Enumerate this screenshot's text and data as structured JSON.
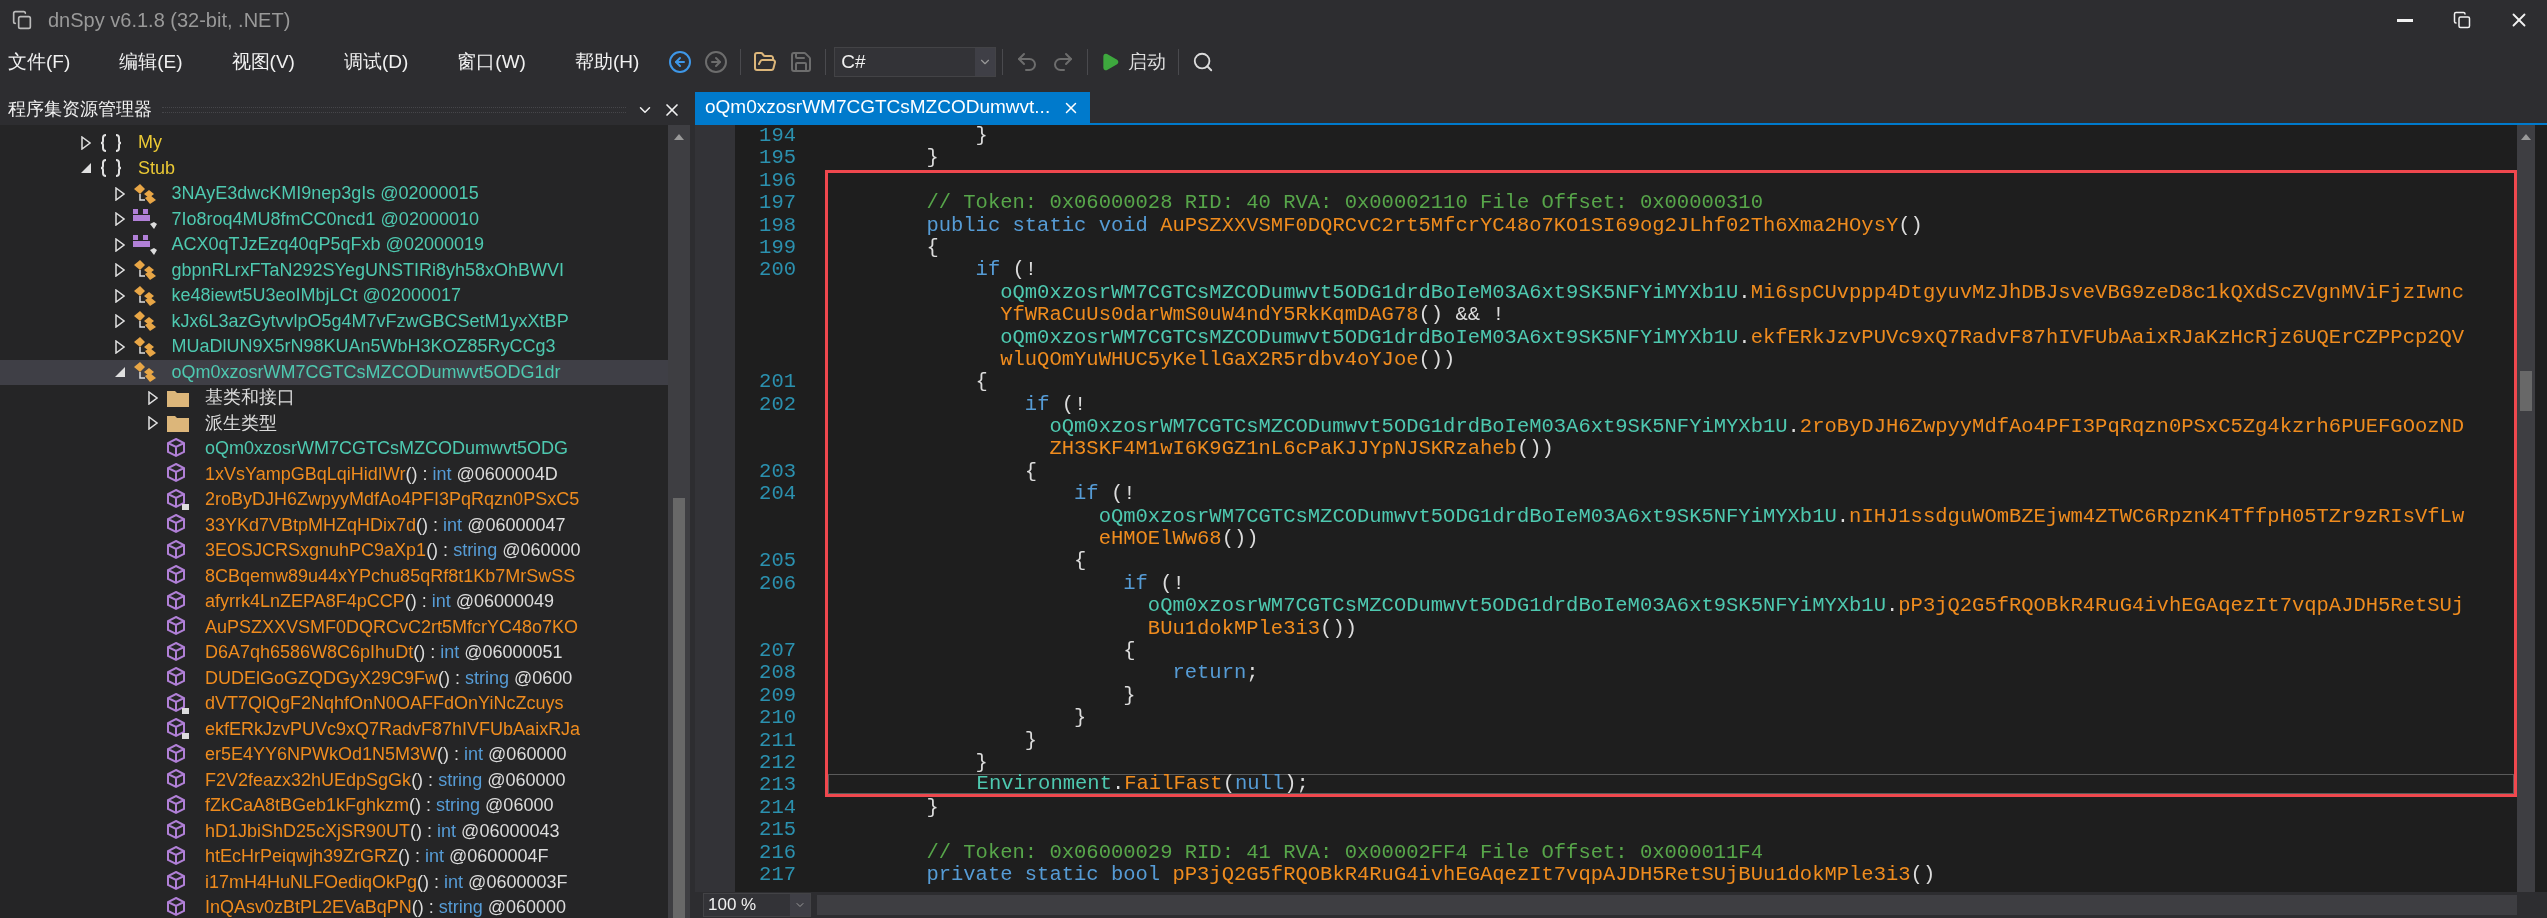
{
  "window": {
    "title": "dnSpy v6.1.8 (32-bit, .NET)"
  },
  "menu": [
    "文件(F)",
    "编辑(E)",
    "视图(V)",
    "调试(D)",
    "窗口(W)",
    "帮助(H)"
  ],
  "toolbar": [
    {
      "kind": "back",
      "disabled": false
    },
    {
      "kind": "forward",
      "disabled": true
    },
    {
      "kind": "separator"
    },
    {
      "kind": "open",
      "disabled": false
    },
    {
      "kind": "save",
      "disabled": true
    },
    {
      "kind": "separator"
    },
    {
      "kind": "language",
      "value": "C#"
    },
    {
      "kind": "separator"
    },
    {
      "kind": "undo",
      "disabled": true
    },
    {
      "kind": "redo",
      "disabled": true
    },
    {
      "kind": "separator"
    },
    {
      "kind": "run",
      "label": "启动",
      "disabled": false
    },
    {
      "kind": "separator"
    },
    {
      "kind": "search",
      "disabled": false
    }
  ],
  "explorer": {
    "title": "程序集资源管理器",
    "tree": [
      {
        "kind": "namespace",
        "label": "My",
        "expanded": false,
        "selected": false
      },
      {
        "kind": "namespace",
        "label": "Stub",
        "expanded": true,
        "selected": false,
        "children": [
          {
            "kind": "class",
            "label": "3NAyE3dwcKMI9nep3gIs @02000015",
            "expanded": false,
            "selected": false
          },
          {
            "kind": "struct",
            "label": "7Io8roq4MU8fmCC0ncd1 @02000010",
            "expanded": false,
            "selected": false
          },
          {
            "kind": "struct",
            "label": "ACX0qTJzEzq40qP5qFxb @02000019",
            "expanded": false,
            "selected": false
          },
          {
            "kind": "class",
            "label": "gbpnRLrxFTaN292SYegUNSTIRi8yh58xOhBWVI",
            "expanded": false,
            "selected": false
          },
          {
            "kind": "class",
            "label": "ke48iewt5U3eoIMbjLCt @02000017",
            "expanded": false,
            "selected": false
          },
          {
            "kind": "class",
            "label": "kJx6L3azGytvvlpO5g4M7vFzwGBCSetM1yxXtBP",
            "expanded": false,
            "selected": false
          },
          {
            "kind": "class",
            "label": "MUaDlUN9X5rN98KUAn5WbH3KOZ85RyCCg3",
            "expanded": false,
            "selected": false
          },
          {
            "kind": "class",
            "label": "oQm0xzosrWM7CGTCsMZCODumwvt5ODG1dr",
            "expanded": true,
            "selected": true,
            "children": [
              {
                "kind": "folder",
                "label": "基类和接口",
                "expanded": false,
                "selected": false
              },
              {
                "kind": "folder",
                "label": "派生类型",
                "expanded": false,
                "selected": false
              },
              {
                "kind": "method",
                "locked": false,
                "selected": false,
                "tokens": [
                  {
                    "kind": "type",
                    "text": "oQm0xzosrWM7CGTCsMZCODumwvt5ODG"
                  }
                ]
              },
              {
                "kind": "method",
                "locked": false,
                "selected": false,
                "tokens": [
                  {
                    "kind": "member",
                    "text": "1xVsYampGBqLqiHidIWr"
                  },
                  {
                    "kind": "plain",
                    "text": "() : "
                  },
                  {
                    "kind": "keyword",
                    "text": "int"
                  },
                  {
                    "kind": "plain",
                    "text": " @0600004D"
                  }
                ]
              },
              {
                "kind": "method",
                "locked": true,
                "selected": false,
                "tokens": [
                  {
                    "kind": "member",
                    "text": "2roByDJH6ZwpyyMdfAo4PFI3PqRqzn0PSxC5"
                  }
                ]
              },
              {
                "kind": "method",
                "locked": false,
                "selected": false,
                "tokens": [
                  {
                    "kind": "member",
                    "text": "33YKd7VBtpMHZqHDix7d"
                  },
                  {
                    "kind": "plain",
                    "text": "() : "
                  },
                  {
                    "kind": "keyword",
                    "text": "int"
                  },
                  {
                    "kind": "plain",
                    "text": " @06000047"
                  }
                ]
              },
              {
                "kind": "method",
                "locked": false,
                "selected": false,
                "tokens": [
                  {
                    "kind": "member",
                    "text": "3EOSJCRSxgnuhPC9aXp1"
                  },
                  {
                    "kind": "plain",
                    "text": "() : "
                  },
                  {
                    "kind": "keyword",
                    "text": "string"
                  },
                  {
                    "kind": "plain",
                    "text": " @060000"
                  }
                ]
              },
              {
                "kind": "method",
                "locked": false,
                "selected": false,
                "tokens": [
                  {
                    "kind": "member",
                    "text": "8CBqemw89u44xYPchu85qRf8t1Kb7MrSwSS"
                  }
                ]
              },
              {
                "kind": "method",
                "locked": false,
                "selected": false,
                "tokens": [
                  {
                    "kind": "member",
                    "text": "afyrrk4LnZEPA8F4pCCP"
                  },
                  {
                    "kind": "plain",
                    "text": "() : "
                  },
                  {
                    "kind": "keyword",
                    "text": "int"
                  },
                  {
                    "kind": "plain",
                    "text": " @06000049"
                  }
                ]
              },
              {
                "kind": "method",
                "locked": false,
                "selected": false,
                "tokens": [
                  {
                    "kind": "member",
                    "text": "AuPSZXXVSMF0DQRCvC2rt5MfcrYC48o7KO"
                  }
                ]
              },
              {
                "kind": "method",
                "locked": false,
                "selected": false,
                "tokens": [
                  {
                    "kind": "member",
                    "text": "D6A7qh6586W8C6pIhuDt"
                  },
                  {
                    "kind": "plain",
                    "text": "() : "
                  },
                  {
                    "kind": "keyword",
                    "text": "int"
                  },
                  {
                    "kind": "plain",
                    "text": " @06000051"
                  }
                ]
              },
              {
                "kind": "method",
                "locked": false,
                "selected": false,
                "tokens": [
                  {
                    "kind": "member",
                    "text": "DUDElGoGZQDGyX29C9Fw"
                  },
                  {
                    "kind": "plain",
                    "text": "() : "
                  },
                  {
                    "kind": "keyword",
                    "text": "string"
                  },
                  {
                    "kind": "plain",
                    "text": " @0600"
                  }
                ]
              },
              {
                "kind": "method",
                "locked": true,
                "selected": false,
                "tokens": [
                  {
                    "kind": "member",
                    "text": "dVT7QlQgF2NqhfOnN0OAFFdOnYiNcZcuys"
                  }
                ]
              },
              {
                "kind": "method",
                "locked": true,
                "selected": false,
                "tokens": [
                  {
                    "kind": "member",
                    "text": "ekfERkJzvPUVc9xQ7RadvF87hIVFUbAaixRJa"
                  }
                ]
              },
              {
                "kind": "method",
                "locked": false,
                "selected": false,
                "tokens": [
                  {
                    "kind": "member",
                    "text": "er5E4YY6NPWkOd1N5M3W"
                  },
                  {
                    "kind": "plain",
                    "text": "() : "
                  },
                  {
                    "kind": "keyword",
                    "text": "int"
                  },
                  {
                    "kind": "plain",
                    "text": " @060000"
                  }
                ]
              },
              {
                "kind": "method",
                "locked": false,
                "selected": false,
                "tokens": [
                  {
                    "kind": "member",
                    "text": "F2V2feazx32hUEdpSgGk"
                  },
                  {
                    "kind": "plain",
                    "text": "() : "
                  },
                  {
                    "kind": "keyword",
                    "text": "string"
                  },
                  {
                    "kind": "plain",
                    "text": " @060000"
                  }
                ]
              },
              {
                "kind": "method",
                "locked": false,
                "selected": false,
                "tokens": [
                  {
                    "kind": "member",
                    "text": "fZkCaA8tBGeb1kFghkzm"
                  },
                  {
                    "kind": "plain",
                    "text": "() : "
                  },
                  {
                    "kind": "keyword",
                    "text": "string"
                  },
                  {
                    "kind": "plain",
                    "text": " @06000"
                  }
                ]
              },
              {
                "kind": "method",
                "locked": false,
                "selected": false,
                "tokens": [
                  {
                    "kind": "member",
                    "text": "hD1JbiShD25cXjSR90UT"
                  },
                  {
                    "kind": "plain",
                    "text": "() : "
                  },
                  {
                    "kind": "keyword",
                    "text": "int"
                  },
                  {
                    "kind": "plain",
                    "text": " @06000043"
                  }
                ]
              },
              {
                "kind": "method",
                "locked": false,
                "selected": false,
                "tokens": [
                  {
                    "kind": "member",
                    "text": "htEcHrPeiqwjh39ZrGRZ"
                  },
                  {
                    "kind": "plain",
                    "text": "() : "
                  },
                  {
                    "kind": "keyword",
                    "text": "int"
                  },
                  {
                    "kind": "plain",
                    "text": " @0600004F"
                  }
                ]
              },
              {
                "kind": "method",
                "locked": false,
                "selected": false,
                "tokens": [
                  {
                    "kind": "member",
                    "text": "i17mH4HuNLFOediqOkPg"
                  },
                  {
                    "kind": "plain",
                    "text": "() : "
                  },
                  {
                    "kind": "keyword",
                    "text": "int"
                  },
                  {
                    "kind": "plain",
                    "text": " @0600003F"
                  }
                ]
              },
              {
                "kind": "method",
                "locked": false,
                "selected": false,
                "tokens": [
                  {
                    "kind": "member",
                    "text": "InQAsv0zBtPL2EVaBqPN"
                  },
                  {
                    "kind": "plain",
                    "text": "() : "
                  },
                  {
                    "kind": "keyword",
                    "text": "string"
                  },
                  {
                    "kind": "plain",
                    "text": " @060000"
                  }
                ]
              }
            ]
          }
        ]
      }
    ]
  },
  "editor": {
    "tabs": [
      {
        "label": "oQm0xzosrWM7CGTCsMZCODumwvt...",
        "selected": true
      }
    ],
    "zoom": "100 %",
    "lines": [
      {
        "number": "194",
        "highlighted": false,
        "current": false,
        "tokens": [
          {
            "kind": "plain",
            "text": "            }"
          }
        ]
      },
      {
        "number": "195",
        "highlighted": false,
        "current": false,
        "tokens": [
          {
            "kind": "plain",
            "text": "        }"
          }
        ]
      },
      {
        "number": "196",
        "highlighted": true,
        "current": false
      },
      {
        "number": "197",
        "highlighted": true,
        "current": false,
        "tokens": [
          {
            "kind": "comment",
            "text": "        // Token: 0x06000028 RID: 40 RVA: 0x00002110 File Offset: 0x00000310"
          }
        ]
      },
      {
        "number": "198",
        "highlighted": true,
        "current": false,
        "tokens": [
          {
            "kind": "keyword",
            "text": "        public static void "
          },
          {
            "kind": "member",
            "text": "AuPSZXXVSMF0DQRCvC2rt5MfcrYC48o7KO1SI69og2JLhf02Th6Xma2HOysY"
          },
          {
            "kind": "plain",
            "text": "()"
          }
        ]
      },
      {
        "number": "199",
        "highlighted": true,
        "current": false,
        "tokens": [
          {
            "kind": "plain",
            "text": "        {"
          }
        ]
      },
      {
        "number": "200",
        "highlighted": true,
        "current": false,
        "tokens": [
          {
            "kind": "keyword",
            "text": "            if"
          },
          {
            "kind": "plain",
            "text": " (!"
          }
        ]
      },
      {
        "highlighted": true,
        "current": false,
        "tokens": [
          {
            "kind": "type",
            "text": "              oQm0xzosrWM7CGTCsMZCODumwvt5ODG1drdBoIeM03A6xt9SK5NFYiMYXb1U"
          },
          {
            "kind": "plain",
            "text": "."
          },
          {
            "kind": "member",
            "text": "Mi6spCUvppp4DtgyuvMzJhDBJsveVBG9zeD8c1kQXdScZVgnMViFjzIwnc"
          }
        ]
      },
      {
        "highlighted": true,
        "current": false,
        "tokens": [
          {
            "kind": "member",
            "text": "              YfWRaCuUs0darWmS0uW4ndY5RkKqmDAG78"
          },
          {
            "kind": "plain",
            "text": "() && !"
          }
        ]
      },
      {
        "highlighted": true,
        "current": false,
        "tokens": [
          {
            "kind": "type",
            "text": "              oQm0xzosrWM7CGTCsMZCODumwvt5ODG1drdBoIeM03A6xt9SK5NFYiMYXb1U"
          },
          {
            "kind": "plain",
            "text": "."
          },
          {
            "kind": "member",
            "text": "ekfERkJzvPUVc9xQ7RadvF87hIVFUbAaixRJaKzHcRjz6UQErCZPPcp2QV"
          }
        ]
      },
      {
        "highlighted": true,
        "current": false,
        "tokens": [
          {
            "kind": "member",
            "text": "              wluQOmYuWHUC5yKellGaX2R5rdbv4oYJoe"
          },
          {
            "kind": "plain",
            "text": "())"
          }
        ]
      },
      {
        "number": "201",
        "highlighted": true,
        "current": false,
        "tokens": [
          {
            "kind": "plain",
            "text": "            {"
          }
        ]
      },
      {
        "number": "202",
        "highlighted": true,
        "current": false,
        "tokens": [
          {
            "kind": "keyword",
            "text": "                if"
          },
          {
            "kind": "plain",
            "text": " (!"
          }
        ]
      },
      {
        "highlighted": true,
        "current": false,
        "tokens": [
          {
            "kind": "type",
            "text": "                  oQm0xzosrWM7CGTCsMZCODumwvt5ODG1drdBoIeM03A6xt9SK5NFYiMYXb1U"
          },
          {
            "kind": "plain",
            "text": "."
          },
          {
            "kind": "member",
            "text": "2roByDJH6ZwpyyMdfAo4PFI3PqRqzn0PSxC5Zg4kzrh6PUEFGOozND"
          }
        ]
      },
      {
        "highlighted": true,
        "current": false,
        "tokens": [
          {
            "kind": "member",
            "text": "                  ZH3SKF4M1wI6K9GZ1nL6cPaKJJYpNJSKRzaheb"
          },
          {
            "kind": "plain",
            "text": "())"
          }
        ]
      },
      {
        "number": "203",
        "highlighted": true,
        "current": false,
        "tokens": [
          {
            "kind": "plain",
            "text": "                {"
          }
        ]
      },
      {
        "number": "204",
        "highlighted": true,
        "current": false,
        "tokens": [
          {
            "kind": "keyword",
            "text": "                    if"
          },
          {
            "kind": "plain",
            "text": " (!"
          }
        ]
      },
      {
        "highlighted": true,
        "current": false,
        "tokens": [
          {
            "kind": "type",
            "text": "                      oQm0xzosrWM7CGTCsMZCODumwvt5ODG1drdBoIeM03A6xt9SK5NFYiMYXb1U"
          },
          {
            "kind": "plain",
            "text": "."
          },
          {
            "kind": "member",
            "text": "nIHJ1ssdguWOmBZEjwm4ZTWC6RpznK4TffpH05TZr9zRIsVfLw"
          }
        ]
      },
      {
        "highlighted": true,
        "current": false,
        "tokens": [
          {
            "kind": "member",
            "text": "                      eHMOElWw68"
          },
          {
            "kind": "plain",
            "text": "())"
          }
        ]
      },
      {
        "number": "205",
        "highlighted": true,
        "current": false,
        "tokens": [
          {
            "kind": "plain",
            "text": "                    {"
          }
        ]
      },
      {
        "number": "206",
        "highlighted": true,
        "current": false,
        "tokens": [
          {
            "kind": "keyword",
            "text": "                        if"
          },
          {
            "kind": "plain",
            "text": " (!"
          }
        ]
      },
      {
        "highlighted": true,
        "current": false,
        "tokens": [
          {
            "kind": "type",
            "text": "                          oQm0xzosrWM7CGTCsMZCODumwvt5ODG1drdBoIeM03A6xt9SK5NFYiMYXb1U"
          },
          {
            "kind": "plain",
            "text": "."
          },
          {
            "kind": "member",
            "text": "pP3jQ2G5fRQOBkR4RuG4ivhEGAqezIt7vqpAJDH5RetSUj"
          }
        ]
      },
      {
        "highlighted": true,
        "current": false,
        "tokens": [
          {
            "kind": "member",
            "text": "                          BUu1dokMPle3i3"
          },
          {
            "kind": "plain",
            "text": "())"
          }
        ]
      },
      {
        "number": "207",
        "highlighted": true,
        "current": false,
        "tokens": [
          {
            "kind": "plain",
            "text": "                        {"
          }
        ]
      },
      {
        "number": "208",
        "highlighted": true,
        "current": false,
        "tokens": [
          {
            "kind": "keyword",
            "text": "                            return"
          },
          {
            "kind": "plain",
            "text": ";"
          }
        ]
      },
      {
        "number": "209",
        "highlighted": true,
        "current": false,
        "tokens": [
          {
            "kind": "plain",
            "text": "                        }"
          }
        ]
      },
      {
        "number": "210",
        "highlighted": true,
        "current": false,
        "tokens": [
          {
            "kind": "plain",
            "text": "                    }"
          }
        ]
      },
      {
        "number": "211",
        "highlighted": true,
        "current": false,
        "tokens": [
          {
            "kind": "plain",
            "text": "                }"
          }
        ]
      },
      {
        "number": "212",
        "highlighted": true,
        "current": false,
        "tokens": [
          {
            "kind": "plain",
            "text": "            }"
          }
        ]
      },
      {
        "number": "213",
        "highlighted": true,
        "current": true,
        "tokens": [
          {
            "kind": "type",
            "text": "            Environment"
          },
          {
            "kind": "plain",
            "text": "."
          },
          {
            "kind": "member",
            "text": "FailFast"
          },
          {
            "kind": "plain",
            "text": "("
          },
          {
            "kind": "keyword",
            "text": "null"
          },
          {
            "kind": "plain",
            "text": ");"
          }
        ]
      },
      {
        "number": "214",
        "highlighted": false,
        "current": false,
        "tokens": [
          {
            "kind": "plain",
            "text": "        }"
          }
        ]
      },
      {
        "number": "215",
        "highlighted": false,
        "current": false
      },
      {
        "number": "216",
        "highlighted": false,
        "current": false,
        "tokens": [
          {
            "kind": "comment",
            "text": "        // Token: 0x06000029 RID: 41 RVA: 0x00002FF4 File Offset: 0x000011F4"
          }
        ]
      },
      {
        "number": "217",
        "highlighted": false,
        "current": false,
        "tokens": [
          {
            "kind": "keyword",
            "text": "        private static bool "
          },
          {
            "kind": "member",
            "text": "pP3jQ2G5fRQOBkR4RuG4ivhEGAqezIt7vqpAJDH5RetSUjBUu1dokMPle3i3"
          },
          {
            "kind": "plain",
            "text": "()"
          }
        ]
      }
    ]
  }
}
